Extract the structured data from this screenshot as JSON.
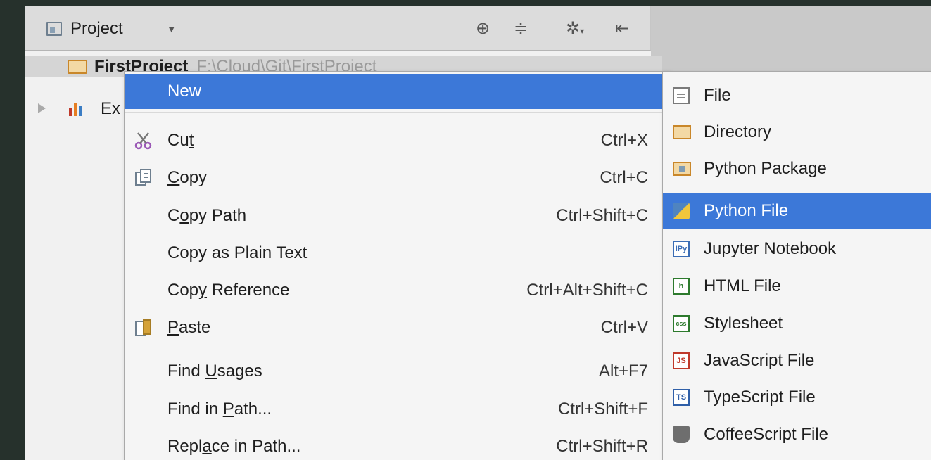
{
  "toolbar": {
    "project_label": "Project",
    "icons": [
      "locate-icon",
      "collapse-icon",
      "gear-icon",
      "hide-panel-icon"
    ]
  },
  "tree": {
    "root_name": "FirstProject",
    "root_path": "F:\\Cloud\\Git\\FirstProject",
    "external_label": "Ex"
  },
  "menu": {
    "new": {
      "label": "New"
    },
    "cut": {
      "label_pre": "Cu",
      "label_u": "t",
      "label_post": "",
      "shortcut": "Ctrl+X"
    },
    "copy": {
      "label_pre": "",
      "label_u": "C",
      "label_post": "opy",
      "shortcut": "Ctrl+C"
    },
    "copy_path": {
      "label_pre": "C",
      "label_u": "o",
      "label_post": "py Path",
      "shortcut": "Ctrl+Shift+C"
    },
    "copy_plain": {
      "label": "Copy as Plain Text"
    },
    "copy_ref": {
      "label_pre": "Cop",
      "label_u": "y",
      "label_post": " Reference",
      "shortcut": "Ctrl+Alt+Shift+C"
    },
    "paste": {
      "label_pre": "",
      "label_u": "P",
      "label_post": "aste",
      "shortcut": "Ctrl+V"
    },
    "find_usages": {
      "label_pre": "Find ",
      "label_u": "U",
      "label_post": "sages",
      "shortcut": "Alt+F7"
    },
    "find_in_path": {
      "label_pre": "Find in ",
      "label_u": "P",
      "label_post": "ath...",
      "shortcut": "Ctrl+Shift+F"
    },
    "replace_in_path": {
      "label_pre": "Repl",
      "label_u": "a",
      "label_post": "ce in Path...",
      "shortcut": "Ctrl+Shift+R"
    }
  },
  "submenu": {
    "items": [
      {
        "label": "File",
        "icon": "file-icon"
      },
      {
        "label": "Directory",
        "icon": "folder-icon"
      },
      {
        "label": "Python Package",
        "icon": "package-icon"
      },
      {
        "label": "Python File",
        "icon": "python-icon"
      },
      {
        "label": "Jupyter Notebook",
        "icon": "jupyter-icon",
        "badge": "IPy"
      },
      {
        "label": "HTML File",
        "icon": "html-icon",
        "badge": "h"
      },
      {
        "label": "Stylesheet",
        "icon": "css-icon",
        "badge": "css"
      },
      {
        "label": "JavaScript File",
        "icon": "js-icon",
        "badge": "JS"
      },
      {
        "label": "TypeScript File",
        "icon": "ts-icon",
        "badge": "TS"
      },
      {
        "label": "CoffeeScript File",
        "icon": "coffee-icon"
      }
    ]
  },
  "colors": {
    "selection": "#3c78d8",
    "menu_bg": "#f5f5f5",
    "folder": "#c9872a"
  }
}
